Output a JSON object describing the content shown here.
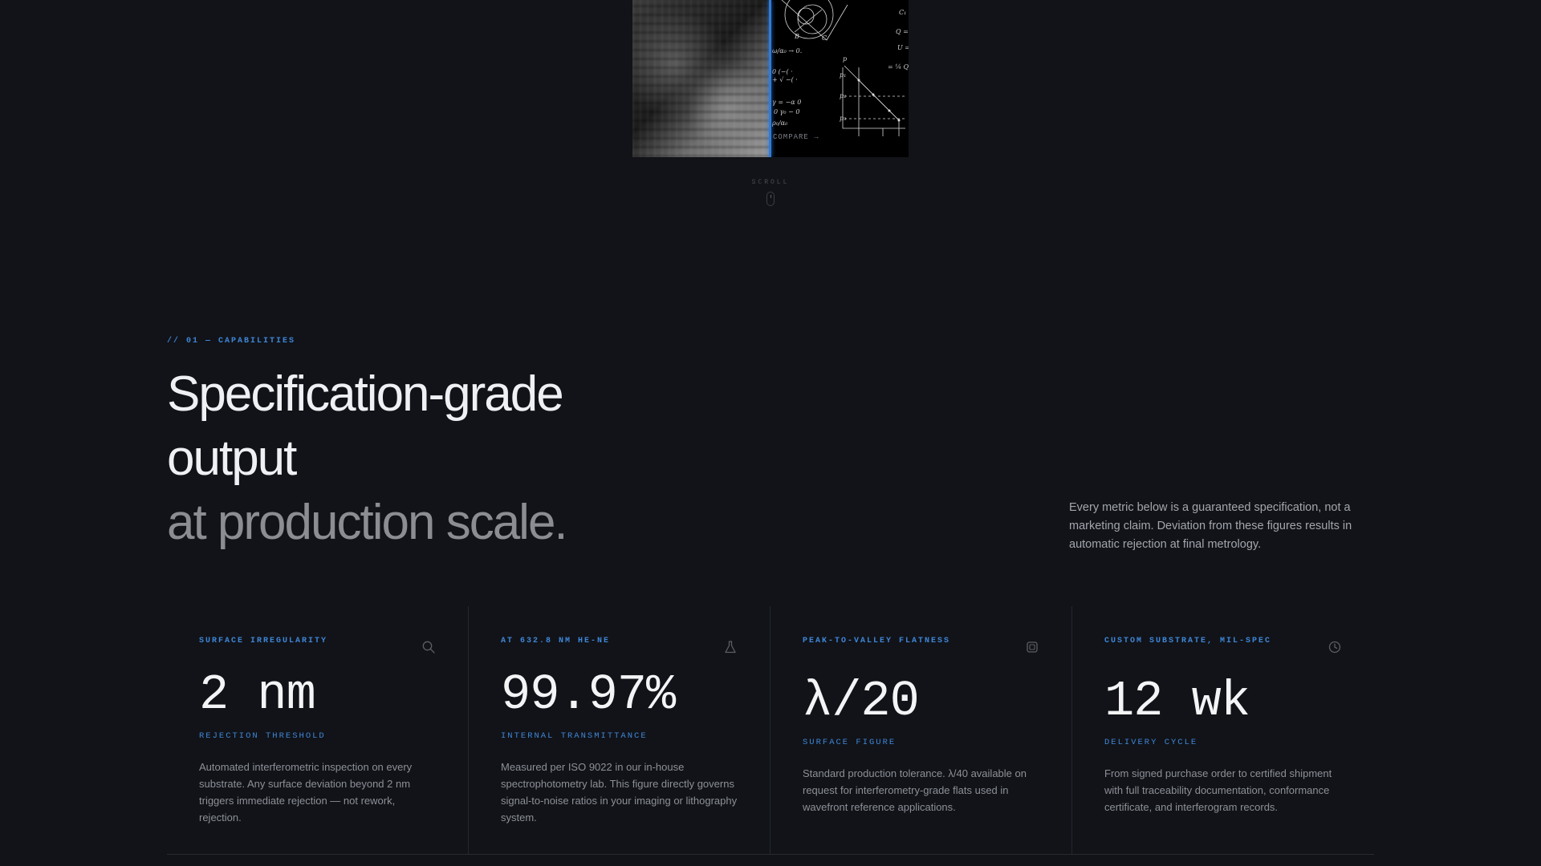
{
  "hero": {
    "compare_label": "COMPARE →",
    "scroll_label": "SCROLL"
  },
  "capabilities": {
    "eyebrow": "// 01 — CAPABILITIES",
    "headline_line1": "Specification-grade",
    "headline_line2": "output",
    "headline_line3": "at production scale.",
    "intro": "Every metric below is a guaranteed specification, not a marketing claim. Deviation from these figures results in automatic rejection at final metrology."
  },
  "metrics": [
    {
      "kicker": "SURFACE IRREGULARITY",
      "icon": "magnifier-icon",
      "value": "2 nm",
      "caption": "REJECTION THRESHOLD",
      "description": "Automated interferometric inspection on every substrate. Any surface deviation beyond 2 nm triggers immediate rejection — not rework, rejection."
    },
    {
      "kicker": "AT 632.8 NM HE-NE",
      "icon": "flask-icon",
      "value": "99.97%",
      "caption": "INTERNAL TRANSMITTANCE",
      "description": "Measured per ISO 9022 in our in-house spectrophotometry lab. This figure directly governs signal-to-noise ratios in your imaging or lithography system."
    },
    {
      "kicker": "PEAK-TO-VALLEY FLATNESS",
      "icon": "chip-icon",
      "value": "λ/20",
      "caption": "SURFACE FIGURE",
      "description": "Standard production tolerance. λ/40 available on request for interferometry-grade flats used in wavefront reference applications."
    },
    {
      "kicker": "CUSTOM SUBSTRATE, MIL-SPEC",
      "icon": "clock-icon",
      "value": "12 wk",
      "caption": "DELIVERY CYCLE",
      "description": "From signed purchase order to certified shipment with full traceability documentation, conformance certificate, and interferogram records."
    }
  ],
  "colors": {
    "background": "#111318",
    "accent": "#3f86d8",
    "divider": "#2f7bd9"
  }
}
